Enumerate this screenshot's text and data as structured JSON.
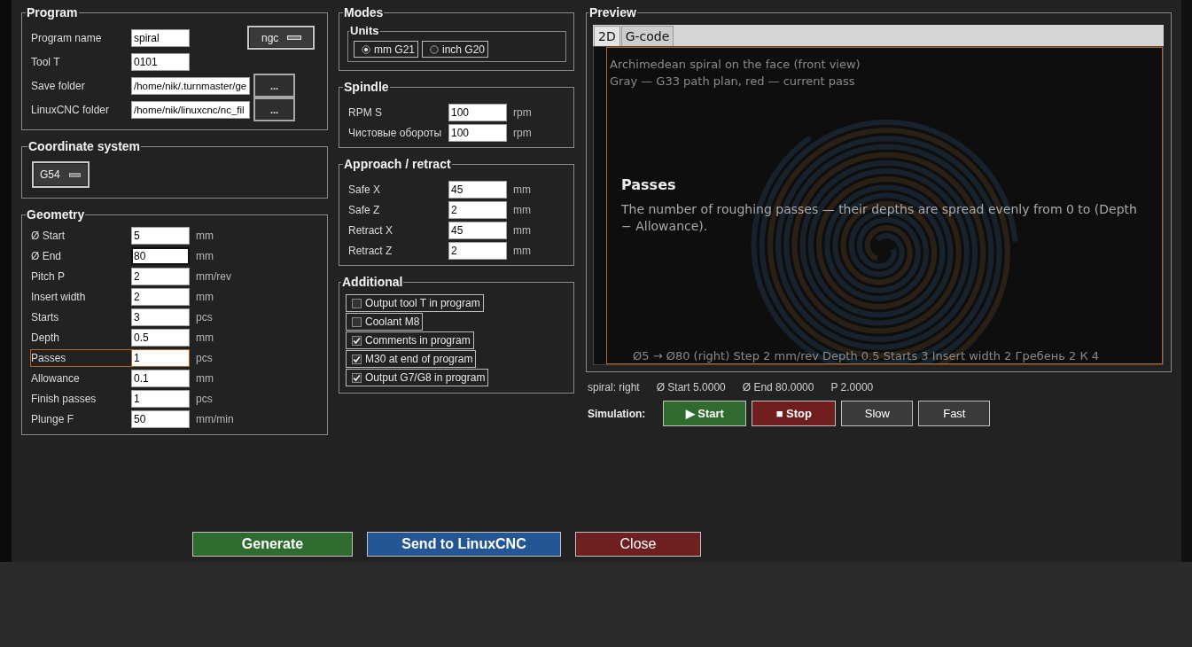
{
  "program": {
    "title": "Program",
    "format": "ngc",
    "fields": [
      {
        "label": "Program name",
        "value": "spiral"
      },
      {
        "label": "Tool T",
        "value": "0101"
      },
      {
        "label": "Save folder",
        "value": "/home/nik/.turnmaster/ge",
        "browse": "..."
      },
      {
        "label": "LinuxCNC folder",
        "value": "/home/nik/linuxcnc/nc_fil",
        "browse": "..."
      }
    ]
  },
  "coordinate_system": {
    "title": "Coordinate system",
    "value": "G54"
  },
  "geometry": {
    "title": "Geometry",
    "fields": [
      {
        "label": "Ø Start",
        "value": "5",
        "unit": "mm",
        "focused": false,
        "hovered": false
      },
      {
        "label": "Ø End",
        "value": "80",
        "unit": "mm",
        "focused": true,
        "hovered": false
      },
      {
        "label": "Pitch P",
        "value": "2",
        "unit": "mm/rev",
        "focused": false,
        "hovered": false
      },
      {
        "label": "Insert width",
        "value": "2",
        "unit": "mm",
        "focused": false,
        "hovered": false
      },
      {
        "label": "Starts",
        "value": "3",
        "unit": "pcs",
        "focused": false,
        "hovered": false
      },
      {
        "label": "Depth",
        "value": "0.5",
        "unit": "mm",
        "focused": false,
        "hovered": false
      },
      {
        "label": "Passes",
        "value": "1",
        "unit": "pcs",
        "focused": false,
        "hovered": true
      },
      {
        "label": "Allowance",
        "value": "0.1",
        "unit": "mm",
        "focused": false,
        "hovered": false
      },
      {
        "label": "Finish passes",
        "value": "1",
        "unit": "pcs",
        "focused": false,
        "hovered": false
      },
      {
        "label": "Plunge F",
        "value": "50",
        "unit": "mm/min",
        "focused": false,
        "hovered": false
      }
    ]
  },
  "modes": {
    "title": "Modes",
    "units": {
      "title": "Units",
      "options": [
        {
          "label": "mm G21",
          "selected": true
        },
        {
          "label": "inch G20",
          "selected": false
        }
      ]
    }
  },
  "spindle": {
    "title": "Spindle",
    "fields": [
      {
        "label": "RPM S",
        "value": "100",
        "unit": "rpm"
      },
      {
        "label": "Чистовые обороты",
        "value": "100",
        "unit": "rpm"
      }
    ]
  },
  "approach": {
    "title": "Approach / retract",
    "fields": [
      {
        "label": "Safe X",
        "value": "45",
        "unit": "mm"
      },
      {
        "label": "Safe Z",
        "value": "2",
        "unit": "mm"
      },
      {
        "label": "Retract X",
        "value": "45",
        "unit": "mm"
      },
      {
        "label": "Retract Z",
        "value": "2",
        "unit": "mm"
      }
    ]
  },
  "additional": {
    "title": "Additional",
    "options": [
      {
        "label": "Output tool T in program",
        "checked": false
      },
      {
        "label": "Coolant M8",
        "checked": false
      },
      {
        "label": "Comments in program",
        "checked": true
      },
      {
        "label": "M30 at end of program",
        "checked": true
      },
      {
        "label": "Output G7/G8 in program",
        "checked": true
      }
    ]
  },
  "preview": {
    "title": "Preview",
    "tabs": [
      {
        "label": "2D",
        "selected": true
      },
      {
        "label": "G-code",
        "selected": false
      }
    ],
    "canvas_lines": [
      "Archimedean spiral on the face (front view)",
      "Gray — G33 path plan, red — current pass"
    ],
    "canvas_footer": "Ø5 → Ø80 (right)   Step 2 mm/rev   Depth 0.5   Starts 3   Insert width 2   Гребень 2   К 4",
    "tooltip": {
      "title": "Passes",
      "text": "The number of roughing passes — their depths are spread evenly from 0 to (Depth − Allowance)."
    }
  },
  "status": [
    "spiral: right",
    "Ø Start 5.0000",
    "Ø End 80.0000",
    "P 2.0000"
  ],
  "simulation": {
    "label": "Simulation:",
    "buttons": [
      {
        "label": "▶ Start",
        "kind": "start"
      },
      {
        "label": "■ Stop",
        "kind": "stop"
      },
      {
        "label": "Slow",
        "kind": "plain"
      },
      {
        "label": "Fast",
        "kind": "plain"
      }
    ]
  },
  "actions": [
    {
      "label": "Generate",
      "kind": "generate"
    },
    {
      "label": "Send to LinuxCNC",
      "kind": "send"
    },
    {
      "label": "Close",
      "kind": "close"
    }
  ]
}
